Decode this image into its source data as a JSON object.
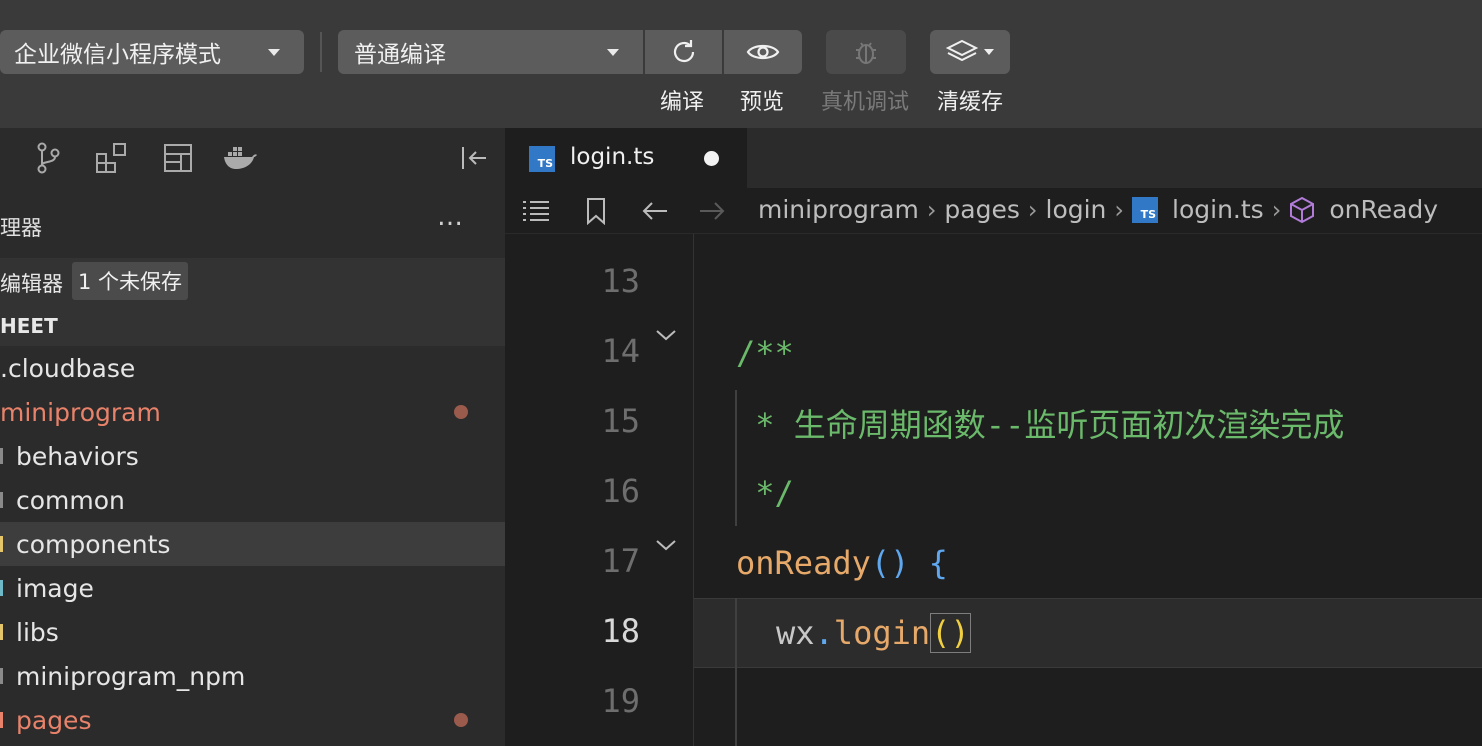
{
  "toolbar": {
    "mode_select": "企业微信小程序模式",
    "compile_select": "普通编译",
    "labels": {
      "compile": "编译",
      "preview": "预览",
      "real_device_debug": "真机调试",
      "clear_cache": "清缓存"
    },
    "icons": [
      "refresh-icon",
      "eye-icon",
      "bug-icon",
      "layers-icon"
    ]
  },
  "sidebar": {
    "activity_icons": [
      "git-branch-icon",
      "extensions-icon",
      "layout-icon",
      "docker-icon",
      "collapse-panel-icon"
    ],
    "explorer_title": "理器",
    "more_label": "…",
    "open_editors_label": "编辑器",
    "unsaved_badge": "1 个未保存",
    "project_label": "HEET",
    "tree": [
      {
        "label": ".cloudbase",
        "indent": false,
        "modified": false,
        "selected": false
      },
      {
        "label": "miniprogram",
        "indent": false,
        "modified": true,
        "selected": false
      },
      {
        "label": "behaviors",
        "indent": true,
        "modified": false,
        "selected": false
      },
      {
        "label": "common",
        "indent": true,
        "modified": false,
        "selected": false
      },
      {
        "label": "components",
        "indent": true,
        "modified": false,
        "selected": true
      },
      {
        "label": "image",
        "indent": true,
        "modified": false,
        "selected": false
      },
      {
        "label": "libs",
        "indent": true,
        "modified": false,
        "selected": false
      },
      {
        "label": "miniprogram_npm",
        "indent": true,
        "modified": false,
        "selected": false
      },
      {
        "label": "pages",
        "indent": true,
        "modified": true,
        "selected": false
      }
    ]
  },
  "editor": {
    "tab": {
      "name": "login.ts",
      "badge": "TS",
      "unsaved": true
    },
    "breadcrumbs": [
      "miniprogram",
      "pages",
      "login",
      "login.ts",
      "onReady"
    ],
    "line_numbers": [
      "13",
      "14",
      "15",
      "16",
      "17",
      "18",
      "19"
    ],
    "current_line": "18",
    "code": {
      "l14": "/**",
      "l15": " * 生命周期函数--监听页面初次渲染完成",
      "l16": " */",
      "l17_func": "onReady",
      "l17_parens": "()",
      "l17_brace": " {",
      "l18_obj": "wx",
      "l18_dot": ".",
      "l18_method": "login",
      "l18_parens": "()"
    }
  },
  "colors": {
    "comment": "#6bb96b",
    "function": "#e6a96a",
    "punctuation": "#5fa8f0",
    "modified": "#e8826a",
    "ts_badge": "#3178c6"
  }
}
